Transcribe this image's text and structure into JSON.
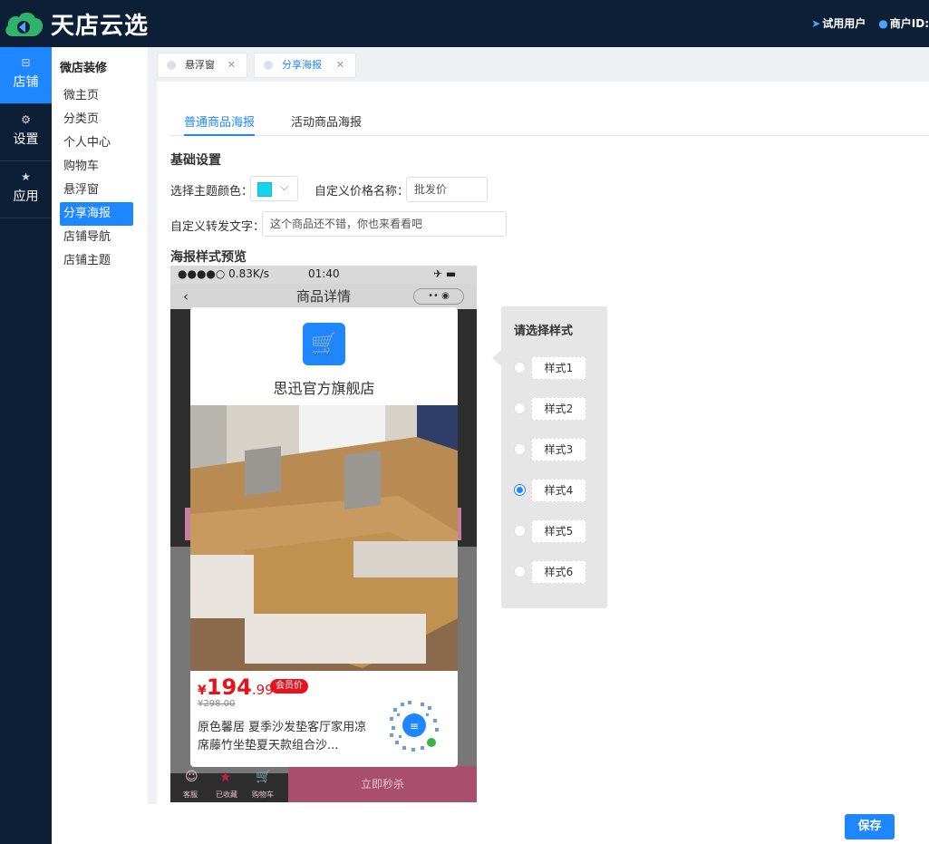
{
  "app": {
    "title": "天店云选"
  },
  "header": {
    "trial_user": "试用用户",
    "merchant_id": "商户ID:"
  },
  "leftnav": [
    {
      "label": "店铺",
      "icon": "shop-icon"
    },
    {
      "label": "设置",
      "icon": "gear-icon"
    },
    {
      "label": "应用",
      "icon": "star-icon"
    }
  ],
  "subnav": {
    "title": "微店装修",
    "items": [
      "微主页",
      "分类页",
      "个人中心",
      "购物车",
      "悬浮窗",
      "分享海报",
      "店铺导航",
      "店铺主题"
    ]
  },
  "tabs": [
    {
      "label": "悬浮窗",
      "close": "✕"
    },
    {
      "label": "分享海报",
      "close": "✕"
    }
  ],
  "poster_tabs": [
    "普通商品海报",
    "活动商品海报"
  ],
  "basic": {
    "title": "基础设置",
    "theme_color_label": "选择主题颜色：",
    "theme_color": "#16d3ee",
    "price_name_label": "自定义价格名称：",
    "price_name_value": "批发价",
    "share_text_label": "自定义转发文字：",
    "share_text_value": "这个商品还不错，你也来看看吧"
  },
  "preview": {
    "title": "海报样式预览",
    "status_left": "●●●●○ 0.83K/s",
    "status_time": "01:40",
    "page_title": "商品详情",
    "buy_label": "立即秒杀",
    "bottom_labels": [
      "客服",
      "已收藏",
      "购物车"
    ],
    "card": {
      "shop_name": "思迅官方旗舰店",
      "currency": "¥",
      "price_int": "194",
      "price_dec": ".99",
      "vip_badge": "会员价",
      "old_price": "¥298.00",
      "product_name": "原色馨居 夏季沙发垫客厅家用凉席藤竹坐垫夏天款组合沙..."
    }
  },
  "style_panel": {
    "title": "请选择样式",
    "options": [
      "样式1",
      "样式2",
      "样式3",
      "样式4",
      "样式5",
      "样式6"
    ],
    "selected_index": 3
  },
  "save_label": "保存"
}
